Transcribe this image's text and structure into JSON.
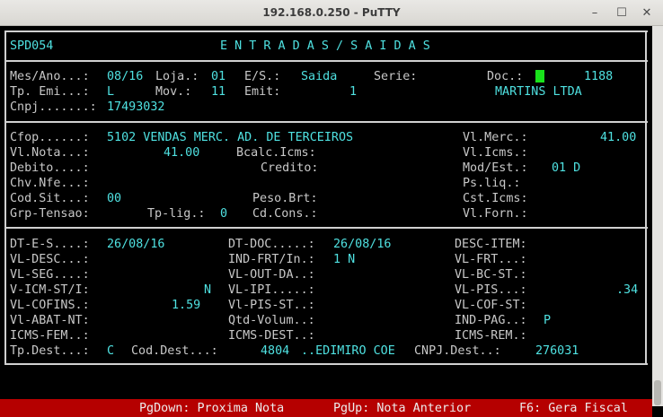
{
  "window": {
    "title": "192.168.0.250 - PuTTY",
    "minimize_glyph": "–",
    "maximize_glyph": "☐",
    "close_glyph": "✕"
  },
  "screen": {
    "program_id": "SPD054",
    "heading": "E N T R A D A S / S A I D A S",
    "header": {
      "mes_ano_label": "Mes/Ano...:",
      "mes_ano": "08/16",
      "loja_label": "Loja.:",
      "loja": "01",
      "es_label": "E/S.:",
      "es": "Saida",
      "serie_label": "Serie:",
      "doc_label": "Doc.:",
      "doc": "1188",
      "tp_emi_label": "Tp. Emi...:",
      "tp_emi": "L",
      "mov_label": "Mov.:",
      "mov": "11",
      "emit_label": "Emit:",
      "emit": "1",
      "emit_name": "MARTINS LTDA",
      "cnpj_label": "Cnpj.......:",
      "cnpj": "17493032"
    },
    "detail": {
      "cfop_label": "Cfop......:",
      "cfop": "5102 VENDAS MERC. AD. DE TERCEIROS",
      "vl_merc_label": "Vl.Merc.:",
      "vl_merc": "41.00",
      "vl_nota_label": "Vl.Nota...:",
      "vl_nota": "41.00",
      "bcalc_icms_label": "Bcalc.Icms:",
      "vl_icms_label": "Vl.Icms.:",
      "debito_label": "Debito....:",
      "credito_label": "Credito:",
      "mod_est_label": "Mod/Est.:",
      "mod_est": "01 D",
      "chv_nfe_label": "Chv.Nfe...:",
      "ps_liq_label": "Ps.liq.:",
      "cod_sit_label": "Cod.Sit...:",
      "cod_sit": "00",
      "peso_brt_label": "Peso.Brt:",
      "cst_icms_label": "Cst.Icms:",
      "grp_tensao_label": "Grp-Tensao:",
      "tp_lig_label": "Tp-lig.:",
      "tp_lig": "0",
      "cd_cons_label": "Cd.Cons.:",
      "vl_forn_label": "Vl.Forn.:"
    },
    "extra": {
      "dt_es_label": "DT-E-S....:",
      "dt_es": "26/08/16",
      "dt_doc_label": "DT-DOC.....:",
      "dt_doc": "26/08/16",
      "desc_item_label": "DESC-ITEM:",
      "vl_desc_label": "VL-DESC...:",
      "ind_frt_label": "IND-FRT/In.:",
      "ind_frt": "1 N",
      "vl_frt_label": "VL-FRT...:",
      "vl_seg_label": "VL-SEG....:",
      "vl_out_da_label": "VL-OUT-DA..:",
      "vl_bc_st_label": "VL-BC-ST.:",
      "v_icm_st_label": "V-ICM-ST/I:",
      "v_icm_st": "N",
      "vl_ipi_label": "VL-IPI.....:",
      "vl_pis_label": "VL-PIS...:",
      "vl_pis": ".34",
      "vl_cofins_label": "VL-COFINS.:",
      "vl_cofins": "1.59",
      "vl_pis_st_label": "Vl-PIS-ST..:",
      "vl_cof_st_label": "VL-COF-ST:",
      "vl_abat_nt_label": "Vl-ABAT-NT:",
      "qtd_volum_label": "Qtd-Volum..:",
      "ind_pag_label": "IND-PAG..:",
      "ind_pag": "P",
      "icms_fem_label": "ICMS-FEM..:",
      "icms_dest_label": "ICMS-DEST..:",
      "icms_rem_label": "ICMS-REM.:",
      "tp_dest_label": "Tp.Dest...:",
      "tp_dest": "C",
      "cod_dest_label": "Cod.Dest...:",
      "cod_dest": "4804",
      "dest_name": "..EDIMIRO COE",
      "cnpj_dest_label": "CNPJ.Dest..:",
      "cnpj_dest": "276031"
    },
    "function_keys": {
      "pgdown": "PgDown: Proxima Nota",
      "pgup": "PgUp: Nota Anterior",
      "f6": "F6: Gera Fiscal"
    }
  },
  "colors": {
    "field_value": "#4fe1e1",
    "label": "#c8c8c8",
    "status_bar": "#b50000",
    "cursor": "#19e21b"
  }
}
